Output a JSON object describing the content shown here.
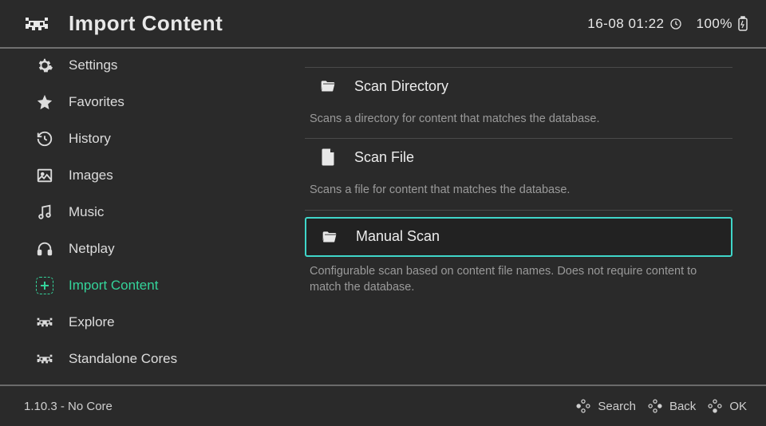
{
  "header": {
    "title": "Import Content",
    "datetime": "16-08 01:22",
    "battery_pct": "100%"
  },
  "sidebar": {
    "items": [
      {
        "label": "Settings",
        "icon": "gear-icon",
        "selected": false
      },
      {
        "label": "Favorites",
        "icon": "star-icon",
        "selected": false
      },
      {
        "label": "History",
        "icon": "history-icon",
        "selected": false
      },
      {
        "label": "Images",
        "icon": "image-icon",
        "selected": false
      },
      {
        "label": "Music",
        "icon": "music-icon",
        "selected": false
      },
      {
        "label": "Netplay",
        "icon": "headset-icon",
        "selected": false
      },
      {
        "label": "Import Content",
        "icon": "plus-box-icon",
        "selected": true
      },
      {
        "label": "Explore",
        "icon": "invader-icon",
        "selected": false
      },
      {
        "label": "Standalone Cores",
        "icon": "invader-icon",
        "selected": false
      }
    ]
  },
  "content": {
    "items": [
      {
        "label": "Scan Directory",
        "desc": "Scans a directory for content that matches the database.",
        "icon": "folder-open-icon",
        "highlighted": false
      },
      {
        "label": "Scan File",
        "desc": "Scans a file for content that matches the database.",
        "icon": "file-icon",
        "highlighted": false
      },
      {
        "label": "Manual Scan",
        "desc": "Configurable scan based on content file names. Does not require content to match the database.",
        "icon": "folder-open-icon",
        "highlighted": true
      }
    ]
  },
  "footer": {
    "version": "1.10.3 - No Core",
    "actions": [
      {
        "label": "Search"
      },
      {
        "label": "Back"
      },
      {
        "label": "OK"
      }
    ]
  },
  "colors": {
    "accent": "#34d39a",
    "highlight_border": "#3fd6c9",
    "bg": "#2a2a2a"
  }
}
